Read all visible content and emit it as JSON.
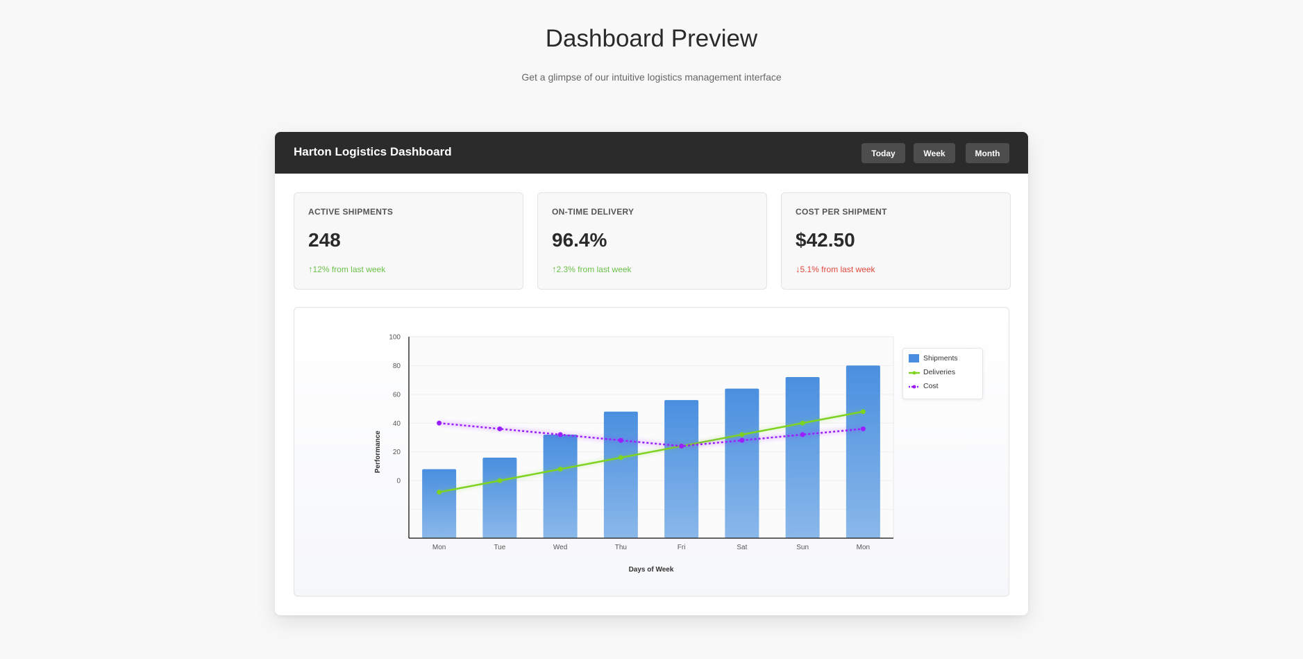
{
  "hero": {
    "title": "Dashboard Preview",
    "subtitle": "Get a glimpse of our intuitive logistics management interface"
  },
  "dashboard": {
    "title": "Harton Logistics Dashboard",
    "range_buttons": {
      "today": "Today",
      "week": "Week",
      "month": "Month"
    }
  },
  "kpis": [
    {
      "label": "ACTIVE SHIPMENTS",
      "value": "248",
      "change": "12% from last week",
      "trend": "up",
      "arrow": "↑"
    },
    {
      "label": "ON-TIME DELIVERY",
      "value": "96.4%",
      "change": "2.3% from last week",
      "trend": "up",
      "arrow": "↑"
    },
    {
      "label": "COST PER SHIPMENT",
      "value": "$42.50",
      "change": "5.1% from last week",
      "trend": "down",
      "arrow": "↓"
    }
  ],
  "colors": {
    "header": "#2b2b2b",
    "up": "#6cc04a",
    "down": "#e0493d",
    "shipments": "#4a8fdf",
    "deliveries": "#7ed321",
    "cost": "#9b1eff"
  },
  "chart_data": {
    "type": "bar",
    "categories": [
      "Mon",
      "Tue",
      "Wed",
      "Thu",
      "Fri",
      "Sat",
      "Sun",
      "Mon"
    ],
    "xlabel": "Days of Week",
    "ylabel": "Performance",
    "yticks": [
      0,
      20,
      40,
      60,
      80,
      100
    ],
    "ylim": [
      -40,
      100
    ],
    "grid": true,
    "legend_position": "right",
    "series": [
      {
        "name": "Shipments",
        "kind": "bar",
        "values": [
          8,
          16,
          32,
          48,
          56,
          64,
          72,
          80
        ]
      },
      {
        "name": "Deliveries",
        "kind": "line",
        "style": "solid",
        "values": [
          -8,
          0,
          8,
          16,
          24,
          32,
          40,
          48
        ]
      },
      {
        "name": "Cost",
        "kind": "line",
        "style": "dotted",
        "values": [
          40,
          36,
          32,
          28,
          24,
          28,
          32,
          36
        ]
      }
    ]
  }
}
